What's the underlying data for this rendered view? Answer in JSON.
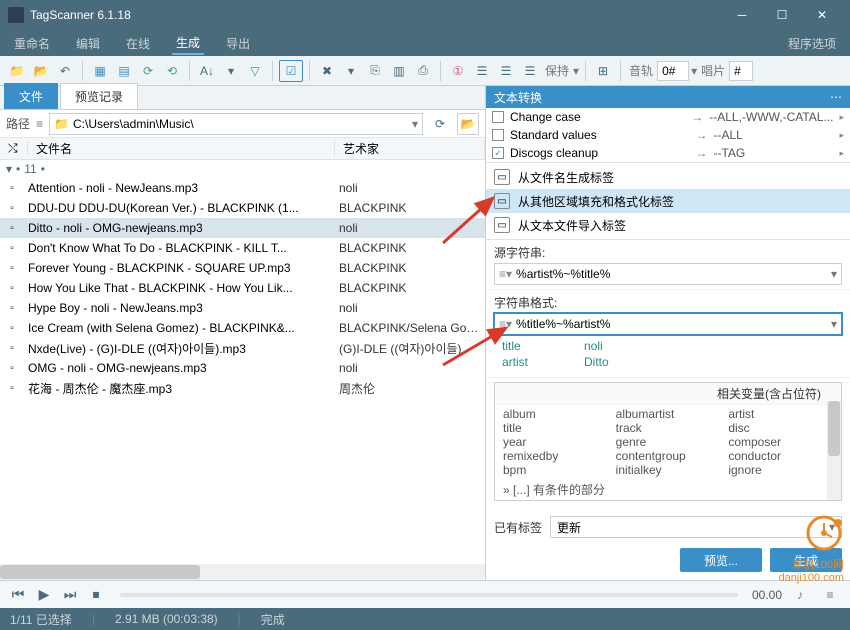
{
  "window": {
    "title": "TagScanner 6.1.18"
  },
  "menu": [
    "重命名",
    "编辑",
    "在线",
    "生成",
    "导出"
  ],
  "menu_right": "程序选项",
  "menu_active_index": 3,
  "toolbar": {
    "keep_label": "保持",
    "track_label": "音轨",
    "track_value": "0#",
    "disc_label": "唱片",
    "disc_value": "#"
  },
  "left_tabs": [
    "文件",
    "预览记录"
  ],
  "path": {
    "label": "路径",
    "value": "C:\\Users\\admin\\Music\\"
  },
  "columns": {
    "name": "文件名",
    "artist": "艺术家"
  },
  "group_count": "11",
  "files": [
    {
      "name": "Attention - noli - NewJeans.mp3",
      "artist": "noli"
    },
    {
      "name": "DDU-DU DDU-DU(Korean Ver.) - BLACKPINK (1...",
      "artist": "BLACKPINK"
    },
    {
      "name": "Ditto - noli - OMG-newjeans.mp3",
      "artist": "noli",
      "selected": true
    },
    {
      "name": "Don't Know What To Do - BLACKPINK - KILL T...",
      "artist": "BLACKPINK"
    },
    {
      "name": "Forever Young - BLACKPINK - SQUARE UP.mp3",
      "artist": "BLACKPINK"
    },
    {
      "name": "How You Like That - BLACKPINK - How You Lik...",
      "artist": "BLACKPINK"
    },
    {
      "name": "Hype Boy - noli - NewJeans.mp3",
      "artist": "noli"
    },
    {
      "name": "Ice Cream (with Selena Gomez) - BLACKPINK&...",
      "artist": "BLACKPINK/Selena Gom..."
    },
    {
      "name": "Nxde(Live) - (G)I-DLE ((여자)아이들).mp3",
      "artist": "(G)I-DLE ((여자)아이들)"
    },
    {
      "name": "OMG - noli - OMG-newjeans.mp3",
      "artist": "noli"
    },
    {
      "name": "花海 - 周杰伦 - 魔杰座.mp3",
      "artist": "周杰伦"
    }
  ],
  "right_header": "文本转换",
  "xforms": [
    {
      "name": "Change case",
      "value": "--ALL,-WWW,-CATAL...",
      "checked": false
    },
    {
      "name": "Standard values",
      "value": "--ALL",
      "checked": false
    },
    {
      "name": "Discogs cleanup",
      "value": "--TAG",
      "checked": true
    }
  ],
  "sources": [
    {
      "label": "从文件名生成标签",
      "active": false
    },
    {
      "label": "从其他区域填充和格式化标签",
      "active": true
    },
    {
      "label": "从文本文件导入标签",
      "active": false
    }
  ],
  "src_string": {
    "label": "源字符串:",
    "value": "%artist%~%title%"
  },
  "fmt_string": {
    "label": "字符串格式:",
    "value": "%title%~%artist%"
  },
  "preview": {
    "title_key": "title",
    "title_val": "noli",
    "artist_key": "artist",
    "artist_val": "Ditto"
  },
  "vars_header": "相关变量(含占位符)",
  "vars": [
    "album",
    "albumartist",
    "artist",
    "title",
    "track",
    "disc",
    "year",
    "genre",
    "composer",
    "remixedby",
    "contentgroup",
    "conductor",
    "bpm",
    "initialkey",
    "ignore"
  ],
  "vars_extra": "» [...] 有条件的部分",
  "existing_tags": {
    "label": "已有标签",
    "value": "更新"
  },
  "buttons": {
    "preview": "预览...",
    "generate": "生成"
  },
  "player": {
    "time": "00.00"
  },
  "status": {
    "selection": "1/11 已选择",
    "size": "2.91 MB (00:03:38)",
    "state": "完成"
  },
  "watermark": {
    "text": "单机100网",
    "url": "danji100.com"
  }
}
